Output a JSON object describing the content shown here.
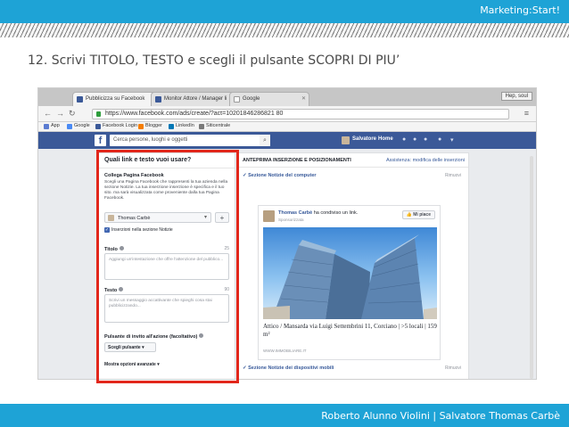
{
  "slide": {
    "brand": "Marketing:Start!",
    "title": "12. Scrivi TITOLO, TESTO e scegli il pulsante SCOPRI DI PIU’",
    "footer": "Roberto Alunno Violini | Salvatore Thomas Carbè",
    "header_color": "#1ea3d6",
    "highlight_color": "#e2271b"
  },
  "browser": {
    "tabs": [
      {
        "label": "Pubblicizza su Facebook",
        "icon": "facebook-favicon-icon"
      },
      {
        "label": "Monitor Attore / Manager li",
        "icon": "facebook-favicon-icon"
      },
      {
        "label": "Google",
        "icon": "google-favicon-icon"
      }
    ],
    "window_label": "Hep, soul",
    "url": "https://www.facebook.com/ads/create/?act=10201846286821 80",
    "bookmarks": [
      {
        "label": "App",
        "color": "#5a7bd1"
      },
      {
        "label": "Google",
        "color": "#4a8af4"
      },
      {
        "label": "Facebook Login",
        "color": "#3b5998"
      },
      {
        "label": "Blogger",
        "color": "#f57d00"
      },
      {
        "label": "LinkedIn",
        "color": "#0077b5"
      },
      {
        "label": "Siticentrale",
        "color": "#7a7a7a"
      }
    ]
  },
  "facebook": {
    "search_placeholder": "Cerca persone, luoghi e oggetti",
    "user_name": "Salvatore",
    "home_label": "Home"
  },
  "ad_form": {
    "title": "Quali link e testo vuoi usare?",
    "page_section": "Collega Pagina Facebook",
    "page_description": "Scegli una Pagina Facebook che rappresenti la tua azienda nella sezione Notizie. La tua inserzione inserzione è specifica e il tuo sito. ma sarà visualizzata come proveniente dalla tua Pagina Facebook.",
    "page_selected": "Thomas Carbè",
    "add_button": "+",
    "newsfeed_checkbox": "Inserzioni nella sezione Notizie",
    "title_label": "Titolo",
    "title_count": "25",
    "title_placeholder": "Aggiungi un'intestazione che offre l'attenzione del pubblico...",
    "text_label": "Testo",
    "text_count": "90",
    "text_placeholder": "Scrivi un messaggio accattivante che spieghi cosa stai pubblicizzando...",
    "cta_label": "Pulsante di invito all'azione (facoltativo)",
    "cta_value": "Scegli pulsante",
    "more_options": "Mostra opzioni avanzate"
  },
  "preview": {
    "title": "ANTEPRIMA INSERZIONE E POSIZIONAMENTI",
    "link": "Assistenza: modifica delle inserzioni",
    "section_desktop": "Sezione Notizie del computer",
    "section_mobile": "Sezione Notizie dei dispositivi mobili",
    "remove": "Rimuovi",
    "post_author": "Thomas Carbè",
    "post_action": "ha condiviso un link.",
    "post_meta": "Sponsorizzata",
    "like_button": "Mi piace",
    "link_title": "Attico / Mansarda via Luigi Settembrini 11, Corciano | >5 locali | 159 m²",
    "link_domain": "WWW.IMMOBILIARE.IT"
  }
}
